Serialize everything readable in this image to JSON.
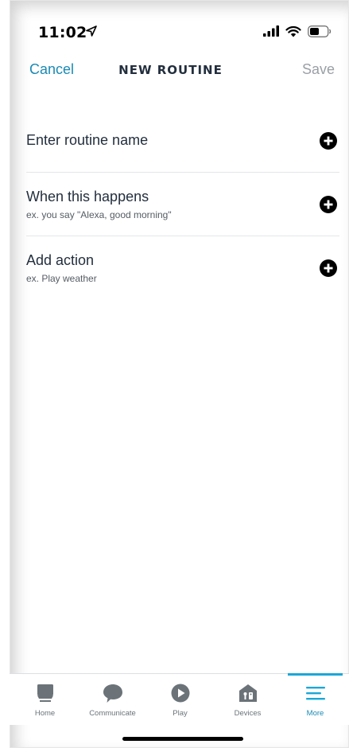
{
  "status_bar": {
    "time": "11:02",
    "location_icon": "location-arrow-icon",
    "signal_icon": "cellular-signal-icon",
    "wifi_icon": "wifi-icon",
    "battery_icon": "battery-icon"
  },
  "navbar": {
    "cancel_label": "Cancel",
    "title": "NEW ROUTINE",
    "save_label": "Save"
  },
  "rows": [
    {
      "title": "Enter routine name",
      "subtitle": "",
      "icon": "add-circle-icon"
    },
    {
      "title": "When this happens",
      "subtitle": "ex. you say \"Alexa, good morning\"",
      "icon": "add-circle-icon"
    },
    {
      "title": "Add action",
      "subtitle": "ex. Play weather",
      "icon": "add-circle-icon"
    }
  ],
  "tabbar": {
    "tabs": [
      {
        "label": "Home",
        "icon": "home-icon",
        "active": false
      },
      {
        "label": "Communicate",
        "icon": "speech-bubble-icon",
        "active": false
      },
      {
        "label": "Play",
        "icon": "play-icon",
        "active": false
      },
      {
        "label": "Devices",
        "icon": "devices-icon",
        "active": false
      },
      {
        "label": "More",
        "icon": "menu-icon",
        "active": true
      }
    ]
  },
  "colors": {
    "accent": "#1a8ab5",
    "text": "#232f3e",
    "disabled": "#9aa0a6",
    "tab_inactive": "#6b7379"
  }
}
